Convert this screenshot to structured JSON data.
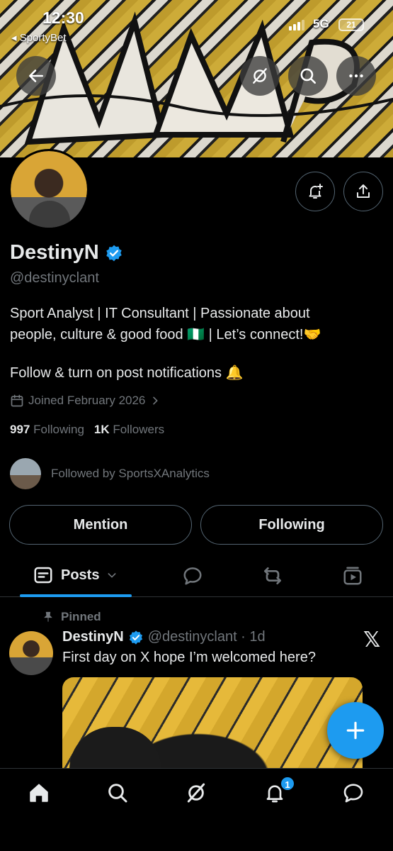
{
  "status_bar": {
    "time": "12:30",
    "back_app": "◂ SportyBet",
    "network": "5G",
    "battery": "21"
  },
  "profile": {
    "name": "DestinyN",
    "handle": "@destinyclant",
    "bio_line1": "Sport Analyst | IT Consultant | Passionate about",
    "bio_line2": "people, culture & good food 🇳🇬 | Let’s connect!🤝",
    "bio_line3": "Follow & turn on post notifications 🔔",
    "joined": "Joined February 2026",
    "following_count": "997",
    "following_label": "Following",
    "followers_count": "1K",
    "followers_label": "Followers",
    "followed_by": "Followed by SportsXAnalytics"
  },
  "actions": {
    "mention": "Mention",
    "following": "Following"
  },
  "tabs": {
    "posts": "Posts"
  },
  "post": {
    "pinned_label": "Pinned",
    "author": "DestinyN",
    "handle_time": "@destinyclant · 1d",
    "text": "First day on X hope I’m welcomed here?",
    "x_logo": "𝕏"
  },
  "nav": {
    "notifications_badge": "1"
  },
  "colors": {
    "accent": "#1d9bf0",
    "background": "#000000",
    "muted": "#71767b",
    "border": "#536471"
  },
  "icons": [
    "arrow-left-icon",
    "grok-icon",
    "search-icon",
    "more-icon",
    "bell-plus-icon",
    "share-icon",
    "verified-icon",
    "calendar-icon",
    "chevron-right-icon",
    "posts-icon",
    "chevron-down-icon",
    "reply-icon",
    "repost-icon",
    "media-icon",
    "pin-icon",
    "plus-icon",
    "home-icon",
    "notifications-icon",
    "messages-icon"
  ]
}
